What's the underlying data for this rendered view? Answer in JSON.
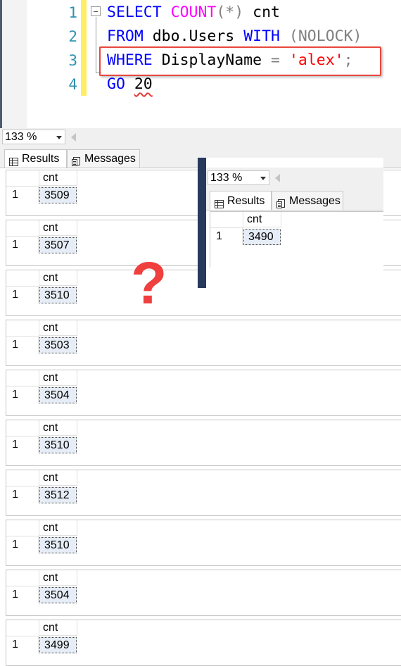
{
  "editor": {
    "line_numbers": [
      "1",
      "2",
      "3",
      "4"
    ],
    "lines": {
      "l1": {
        "kw1": "SELECT",
        "fn": "COUNT",
        "args": "(*)",
        "alias": "cnt"
      },
      "l2": {
        "kw1": "FROM",
        "table": "dbo.Users",
        "kw2": "WITH",
        "hint": "(NOLOCK)"
      },
      "l3": {
        "kw1": "WHERE",
        "column": "DisplayName",
        "op": "=",
        "value": "'alex'",
        "semi": ";"
      },
      "l4": {
        "kw1": "GO",
        "count": "20"
      }
    },
    "highlight_color": "#e8473d"
  },
  "results_panel": {
    "zoom": "133 %",
    "tabs": {
      "results": "Results",
      "messages": "Messages"
    },
    "column_header": "cnt",
    "row_number": "1",
    "counts": [
      "3509",
      "3507",
      "3510",
      "3503",
      "3504",
      "3510",
      "3512",
      "3510",
      "3504",
      "3499"
    ]
  },
  "inset": {
    "zoom": "133 %",
    "tabs": {
      "results": "Results",
      "messages": "Messages"
    },
    "column_header": "cnt",
    "row_number": "1",
    "count": "3490"
  },
  "annotation": {
    "symbol": "?",
    "color": "#ef3f3f"
  }
}
